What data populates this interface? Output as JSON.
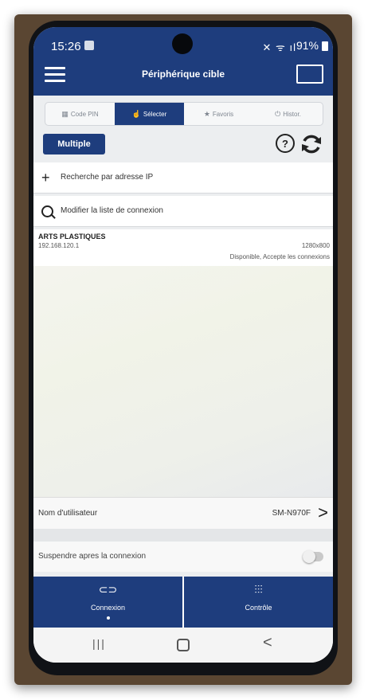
{
  "status_bar": {
    "time": "15:26",
    "icons": "✕ ᯤ ıl",
    "battery": "91%"
  },
  "app_bar": {
    "title": "Périphérique cible"
  },
  "tabs": [
    {
      "icon": "▦",
      "label": "Code PIN"
    },
    {
      "icon": "☝",
      "label": "Sélecter"
    },
    {
      "icon": "★",
      "label": "Favoris"
    },
    {
      "icon": "⏻",
      "label": "Histor."
    }
  ],
  "toolbar": {
    "multiple_label": "Multiple",
    "help_symbol": "?"
  },
  "list": {
    "add_ip_icon": "+",
    "add_ip_label": "Recherche par adresse IP",
    "modify_label": "Modifier la liste de connexion"
  },
  "device": {
    "name": "ARTS PLASTIQUES",
    "ip": "192.168.120.1",
    "resolution": "1280x800",
    "status": "Disponible, Accepte les connexions"
  },
  "settings": {
    "username_label": "Nom d'utilisateur",
    "username_value": "SM-N970F",
    "chevron": ">",
    "suspend_label": "Suspendre apres la connexion"
  },
  "bottom_nav": {
    "connect_icon": "⊂⊃",
    "connect_label": "Connexion",
    "control_icon": "⫶⫶⫶",
    "control_label": "Contrôle"
  },
  "system_nav": {
    "recents": "|||",
    "back": "<"
  },
  "colors": {
    "primary": "#1e3d7d"
  }
}
